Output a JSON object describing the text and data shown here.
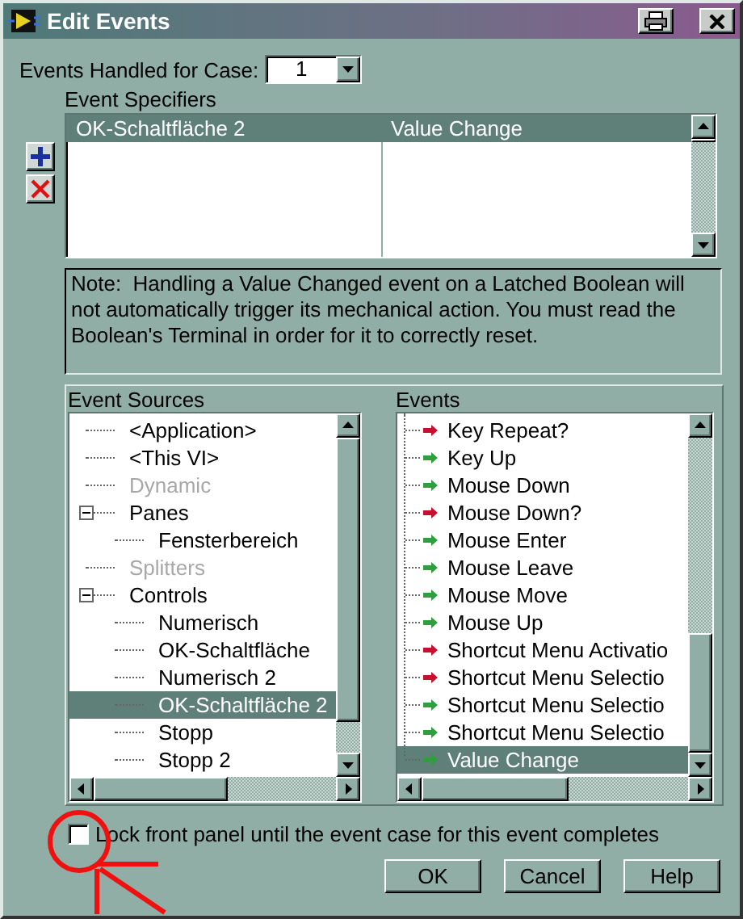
{
  "window": {
    "title": "Edit Events"
  },
  "case_selector": {
    "label": "Events Handled for Case:",
    "value": "1"
  },
  "event_specifiers": {
    "label": "Event Specifiers",
    "rows": [
      {
        "source": "OK-Schaltfläche 2",
        "event": "Value Change",
        "selected": true
      }
    ]
  },
  "note": "Note:  Handling a Value Changed event on a Latched Boolean will not automatically trigger its mechanical action. You must read the Boolean's Terminal in order for it to correctly reset.",
  "event_sources": {
    "label": "Event Sources",
    "items": [
      {
        "label": "<Application>",
        "selected": false,
        "disabled": false
      },
      {
        "label": "<This VI>",
        "selected": false,
        "disabled": false
      },
      {
        "label": "Dynamic",
        "selected": false,
        "disabled": true
      },
      {
        "label": "Panes",
        "selected": false,
        "disabled": false,
        "expanded": true,
        "children": [
          {
            "label": "Fensterbereich",
            "selected": false,
            "disabled": false
          }
        ]
      },
      {
        "label": "Splitters",
        "selected": false,
        "disabled": true
      },
      {
        "label": "Controls",
        "selected": false,
        "disabled": false,
        "expanded": true,
        "children": [
          {
            "label": "Numerisch",
            "selected": false,
            "disabled": false
          },
          {
            "label": "OK-Schaltfläche",
            "selected": false,
            "disabled": false
          },
          {
            "label": "Numerisch 2",
            "selected": false,
            "disabled": false
          },
          {
            "label": "OK-Schaltfläche 2",
            "selected": true,
            "disabled": false
          },
          {
            "label": "Stopp",
            "selected": false,
            "disabled": false
          },
          {
            "label": "Stopp 2",
            "selected": false,
            "disabled": false
          }
        ]
      }
    ]
  },
  "events": {
    "label": "Events",
    "items": [
      {
        "label": "Key Repeat?",
        "color": "#c8102e",
        "selected": false
      },
      {
        "label": "Key Up",
        "color": "#2e9e3e",
        "selected": false
      },
      {
        "label": "Mouse Down",
        "color": "#2e9e3e",
        "selected": false
      },
      {
        "label": "Mouse Down?",
        "color": "#c8102e",
        "selected": false
      },
      {
        "label": "Mouse Enter",
        "color": "#2e9e3e",
        "selected": false
      },
      {
        "label": "Mouse Leave",
        "color": "#2e9e3e",
        "selected": false
      },
      {
        "label": "Mouse Move",
        "color": "#2e9e3e",
        "selected": false
      },
      {
        "label": "Mouse Up",
        "color": "#2e9e3e",
        "selected": false
      },
      {
        "label": "Shortcut Menu Activatio",
        "color": "#c8102e",
        "selected": false
      },
      {
        "label": "Shortcut Menu Selectio",
        "color": "#c8102e",
        "selected": false
      },
      {
        "label": "Shortcut Menu Selectio",
        "color": "#2e9e3e",
        "selected": false
      },
      {
        "label": "Shortcut Menu Selectio",
        "color": "#2e9e3e",
        "selected": false
      },
      {
        "label": "Value Change",
        "color": "#2e9e3e",
        "selected": true
      }
    ]
  },
  "lock_checkbox": {
    "label": "Lock front panel until the event case for this event completes",
    "checked": false
  },
  "buttons": [
    "OK",
    "Cancel",
    "Help"
  ]
}
